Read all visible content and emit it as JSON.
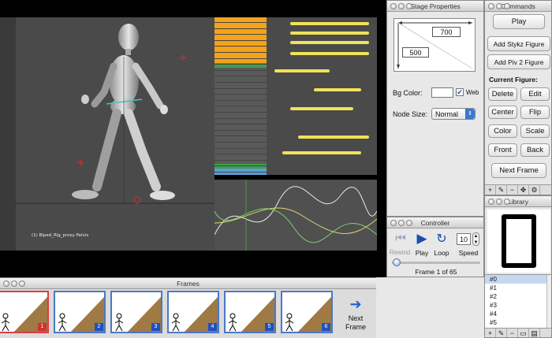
{
  "stage": {
    "title": "Stage Properties",
    "width_value": "700",
    "height_value": "500",
    "bg_color_label": "Bg Color:",
    "web_label": "Web",
    "node_size_label": "Node Size:",
    "node_size_value": "Normal"
  },
  "commands": {
    "title": "Commands",
    "play": "Play",
    "add_stykz": "Add Stykz Figure",
    "add_piv": "Add Piv 2 Figure",
    "current_figure": "Current Figure:",
    "delete": "Delete",
    "edit": "Edit",
    "center": "Center",
    "flip": "Flip",
    "color": "Color",
    "scale": "Scale",
    "front": "Front",
    "back": "Back",
    "next_frame": "Next Frame"
  },
  "controller": {
    "title": "Controller",
    "rewind": "Rewind",
    "play": "Play",
    "loop": "Loop",
    "speed_label": "Speed",
    "speed_value": "10",
    "frame_status": "Frame 1 of 65"
  },
  "library": {
    "title": "Library",
    "items": [
      "#0",
      "#1",
      "#2",
      "#3",
      "#4",
      "#5"
    ]
  },
  "frames": {
    "title": "Frames",
    "numbers": [
      "1",
      "2",
      "3",
      "4",
      "5",
      "6"
    ],
    "next_label_1": "Next",
    "next_label_2": "Frame"
  },
  "video": {
    "viewport_caption": "(1) Biped_Rig_proxy Pelvis"
  },
  "colors": {
    "accent_blue": "#2050c0",
    "selected_red": "#d03030",
    "track_yellow": "#f0e25a",
    "channel_orange": "#f5a31a",
    "channel_green": "#3fa04a"
  }
}
